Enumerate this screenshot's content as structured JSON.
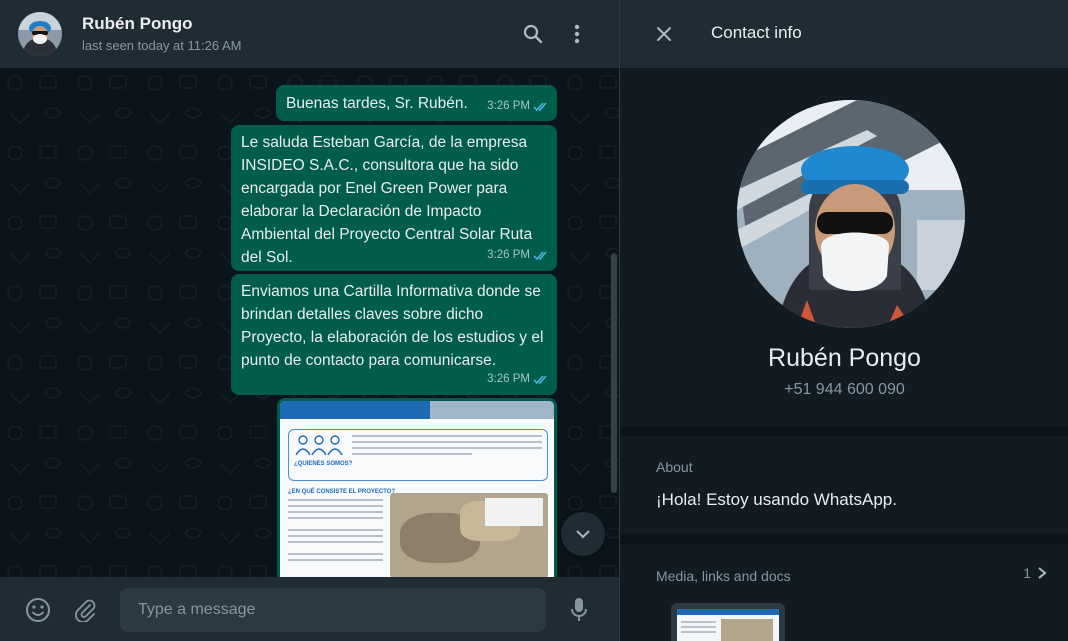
{
  "chat": {
    "contact_name": "Rubén Pongo",
    "last_seen": "last seen today at 11:26 AM",
    "messages": [
      {
        "text": "Buenas tardes, Sr. Rubén.",
        "time": "3:26 PM"
      },
      {
        "text": "Le saluda Esteban García, de la empresa INSIDEO S.A.C., consultora que ha sido encargada por Enel Green Power para elaborar la Declaración de Impacto Ambiental del Proyecto Central Solar Ruta del Sol.",
        "time": "3:26 PM"
      },
      {
        "text": "Enviamos una Cartilla Informativa donde se brindan detalles claves sobre dicho Proyecto, la elaboración de los estudios y el punto de contacto para comunicarse.",
        "time": "3:26 PM"
      }
    ],
    "document": {
      "heading_1": "¿QUIENES SOMOS?",
      "heading_2": "¿EN QUÉ CONSISTE EL PROYECTO?"
    },
    "composer": {
      "placeholder": "Type a message"
    }
  },
  "contact_info": {
    "title": "Contact info",
    "name": "Rubén Pongo",
    "phone": "+51 944 600 090",
    "about_label": "About",
    "about_text": "¡Hola! Estoy usando WhatsApp.",
    "media_label": "Media, links and docs",
    "media_count": "1"
  },
  "colors": {
    "outgoing_bubble": "#005c4b",
    "panel": "#202c33",
    "background": "#111b21",
    "read_tick": "#53bdeb"
  }
}
